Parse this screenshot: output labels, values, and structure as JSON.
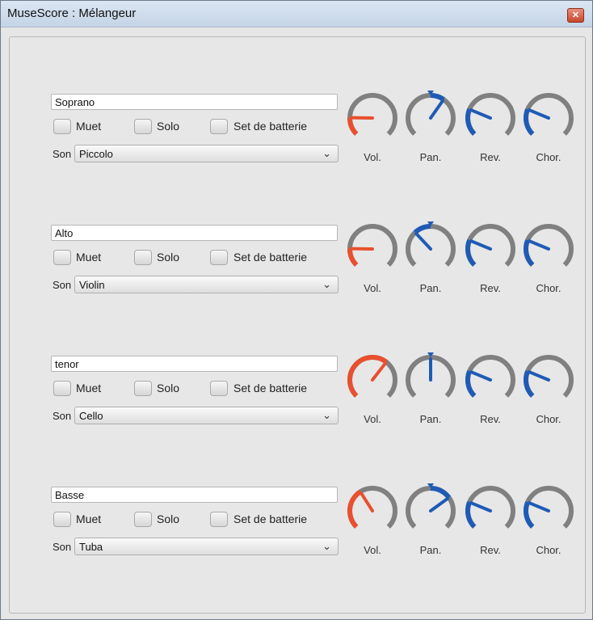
{
  "window": {
    "title": "MuseScore : Mélangeur"
  },
  "labels": {
    "mute": "Muet",
    "solo": "Solo",
    "drumset": "Set de batterie",
    "sound": "Son",
    "vol": "Vol.",
    "pan": "Pan.",
    "rev": "Rev.",
    "chor": "Chor."
  },
  "colors": {
    "vol_accent": "#e8502f",
    "knob_accent": "#1f5bb5",
    "knob_track": "#808080"
  },
  "channels": [
    {
      "name": "Soprano",
      "sound": "Piccolo",
      "knobs": {
        "vol": 0.17,
        "pan": 0.63,
        "rev": 0.25,
        "chor": 0.25
      }
    },
    {
      "name": "Alto",
      "sound": "Violin",
      "knobs": {
        "vol": 0.17,
        "pan": 0.34,
        "rev": 0.25,
        "chor": 0.25
      }
    },
    {
      "name": "tenor",
      "sound": "Cello",
      "knobs": {
        "vol": 0.64,
        "pan": 0.5,
        "rev": 0.25,
        "chor": 0.25
      }
    },
    {
      "name": "Basse",
      "sound": "Tuba",
      "knobs": {
        "vol": 0.38,
        "pan": 0.7,
        "rev": 0.25,
        "chor": 0.25
      }
    }
  ]
}
